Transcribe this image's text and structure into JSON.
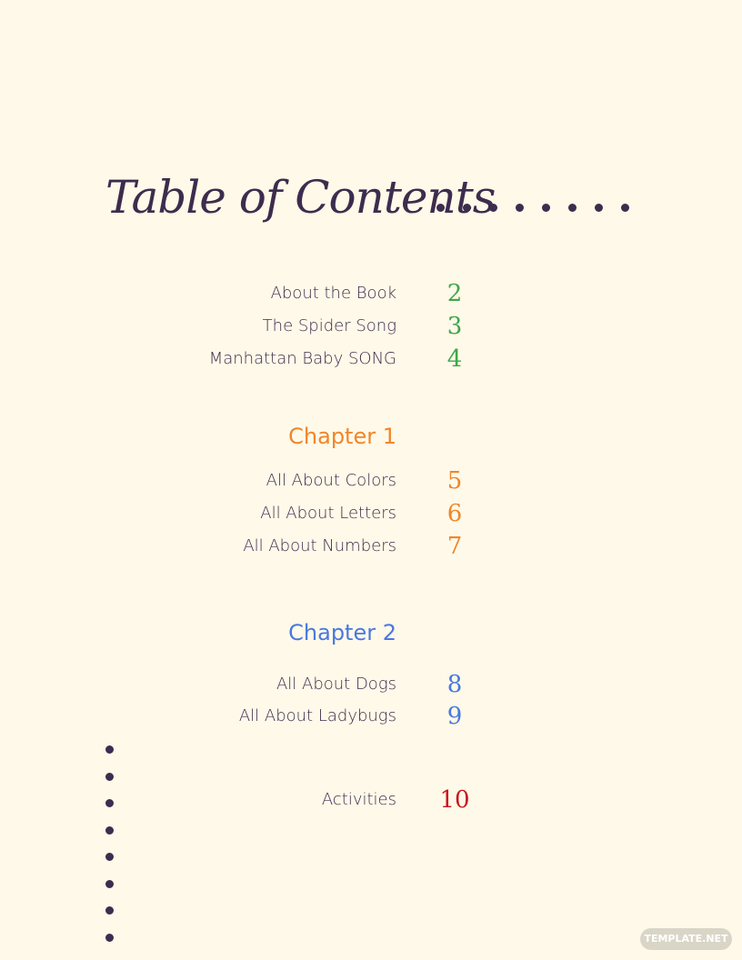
{
  "title": "Table of Contents",
  "colors": {
    "background": "#fef9e8",
    "text": "#3d2c4e",
    "intro": "#3fa64a",
    "chapter1": "#f0862a",
    "chapter2": "#4a78e0",
    "activities": "#c8141e"
  },
  "intro": [
    {
      "label": "About the Book",
      "page": "2"
    },
    {
      "label": "The Spider Song",
      "page": "3"
    },
    {
      "label": "Manhattan Baby SONG",
      "page": "4"
    }
  ],
  "chapter1": {
    "heading": "Chapter 1",
    "items": [
      {
        "label": "All About Colors",
        "page": "5"
      },
      {
        "label": "All About Letters",
        "page": "6"
      },
      {
        "label": "All About Numbers",
        "page": "7"
      }
    ]
  },
  "chapter2": {
    "heading": "Chapter 2",
    "items": [
      {
        "label": "All About Dogs",
        "page": "8"
      },
      {
        "label": "All About Ladybugs",
        "page": "9"
      }
    ]
  },
  "activities": {
    "label": "Activities",
    "page": "10"
  },
  "watermark": "TEMPLATE.NET"
}
